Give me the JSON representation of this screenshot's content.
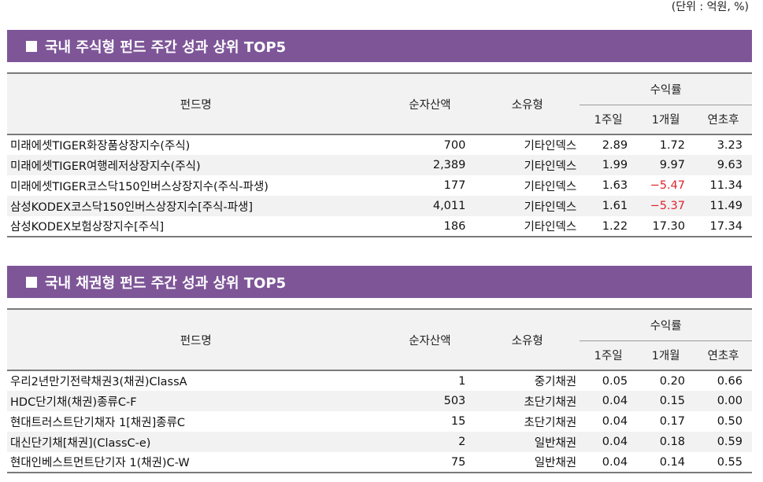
{
  "unit_note": "(단위 : 억원, %)",
  "headers": {
    "fund_name": "펀드명",
    "net_assets": "순자산액",
    "category": "소유형",
    "returns": "수익률",
    "week1": "1주일",
    "month1": "1개월",
    "ytd": "연초후"
  },
  "equity": {
    "title": "국내 주식형 펀드 주간 성과 상위 TOP5",
    "rows": [
      {
        "name": "미래에셋TIGER화장품상장지수(주식)",
        "assets": "700",
        "type": "기타인덱스",
        "w1": "2.89",
        "m1": "1.72",
        "ytd": "3.23"
      },
      {
        "name": "미래에셋TIGER여행레저상장지수(주식)",
        "assets": "2,389",
        "type": "기타인덱스",
        "w1": "1.99",
        "m1": "9.97",
        "ytd": "9.63"
      },
      {
        "name": "미래에셋TIGER코스닥150인버스상장지수(주식-파생)",
        "assets": "177",
        "type": "기타인덱스",
        "w1": "1.63",
        "m1": "−5.47",
        "ytd": "11.34"
      },
      {
        "name": "삼성KODEX코스닥150인버스상장지수[주식-파생]",
        "assets": "4,011",
        "type": "기타인덱스",
        "w1": "1.61",
        "m1": "−5.37",
        "ytd": "11.49"
      },
      {
        "name": "삼성KODEX보험상장지수[주식]",
        "assets": "186",
        "type": "기타인덱스",
        "w1": "1.22",
        "m1": "17.30",
        "ytd": "17.34"
      }
    ]
  },
  "bond": {
    "title": "국내 채권형 펀드 주간 성과 상위 TOP5",
    "rows": [
      {
        "name": "우리2년만기전략채권3(채권)ClassA",
        "assets": "1",
        "type": "중기채권",
        "w1": "0.05",
        "m1": "0.20",
        "ytd": "0.66"
      },
      {
        "name": "HDC단기채(채권)종류C-F",
        "assets": "503",
        "type": "초단기채권",
        "w1": "0.04",
        "m1": "0.15",
        "ytd": "0.00"
      },
      {
        "name": "현대트러스트단기채자 1[채권]종류C",
        "assets": "15",
        "type": "초단기채권",
        "w1": "0.04",
        "m1": "0.17",
        "ytd": "0.50"
      },
      {
        "name": "대신단기채[채권](ClassC-e)",
        "assets": "2",
        "type": "일반채권",
        "w1": "0.04",
        "m1": "0.18",
        "ytd": "0.59"
      },
      {
        "name": "현대인베스트먼트단기자 1(채권)C-W",
        "assets": "75",
        "type": "일반채권",
        "w1": "0.04",
        "m1": "0.14",
        "ytd": "0.55"
      }
    ]
  },
  "colors": {
    "title_bar": "#7e5698",
    "negative": "#e0242f",
    "stripe": "#f2f2f2"
  }
}
